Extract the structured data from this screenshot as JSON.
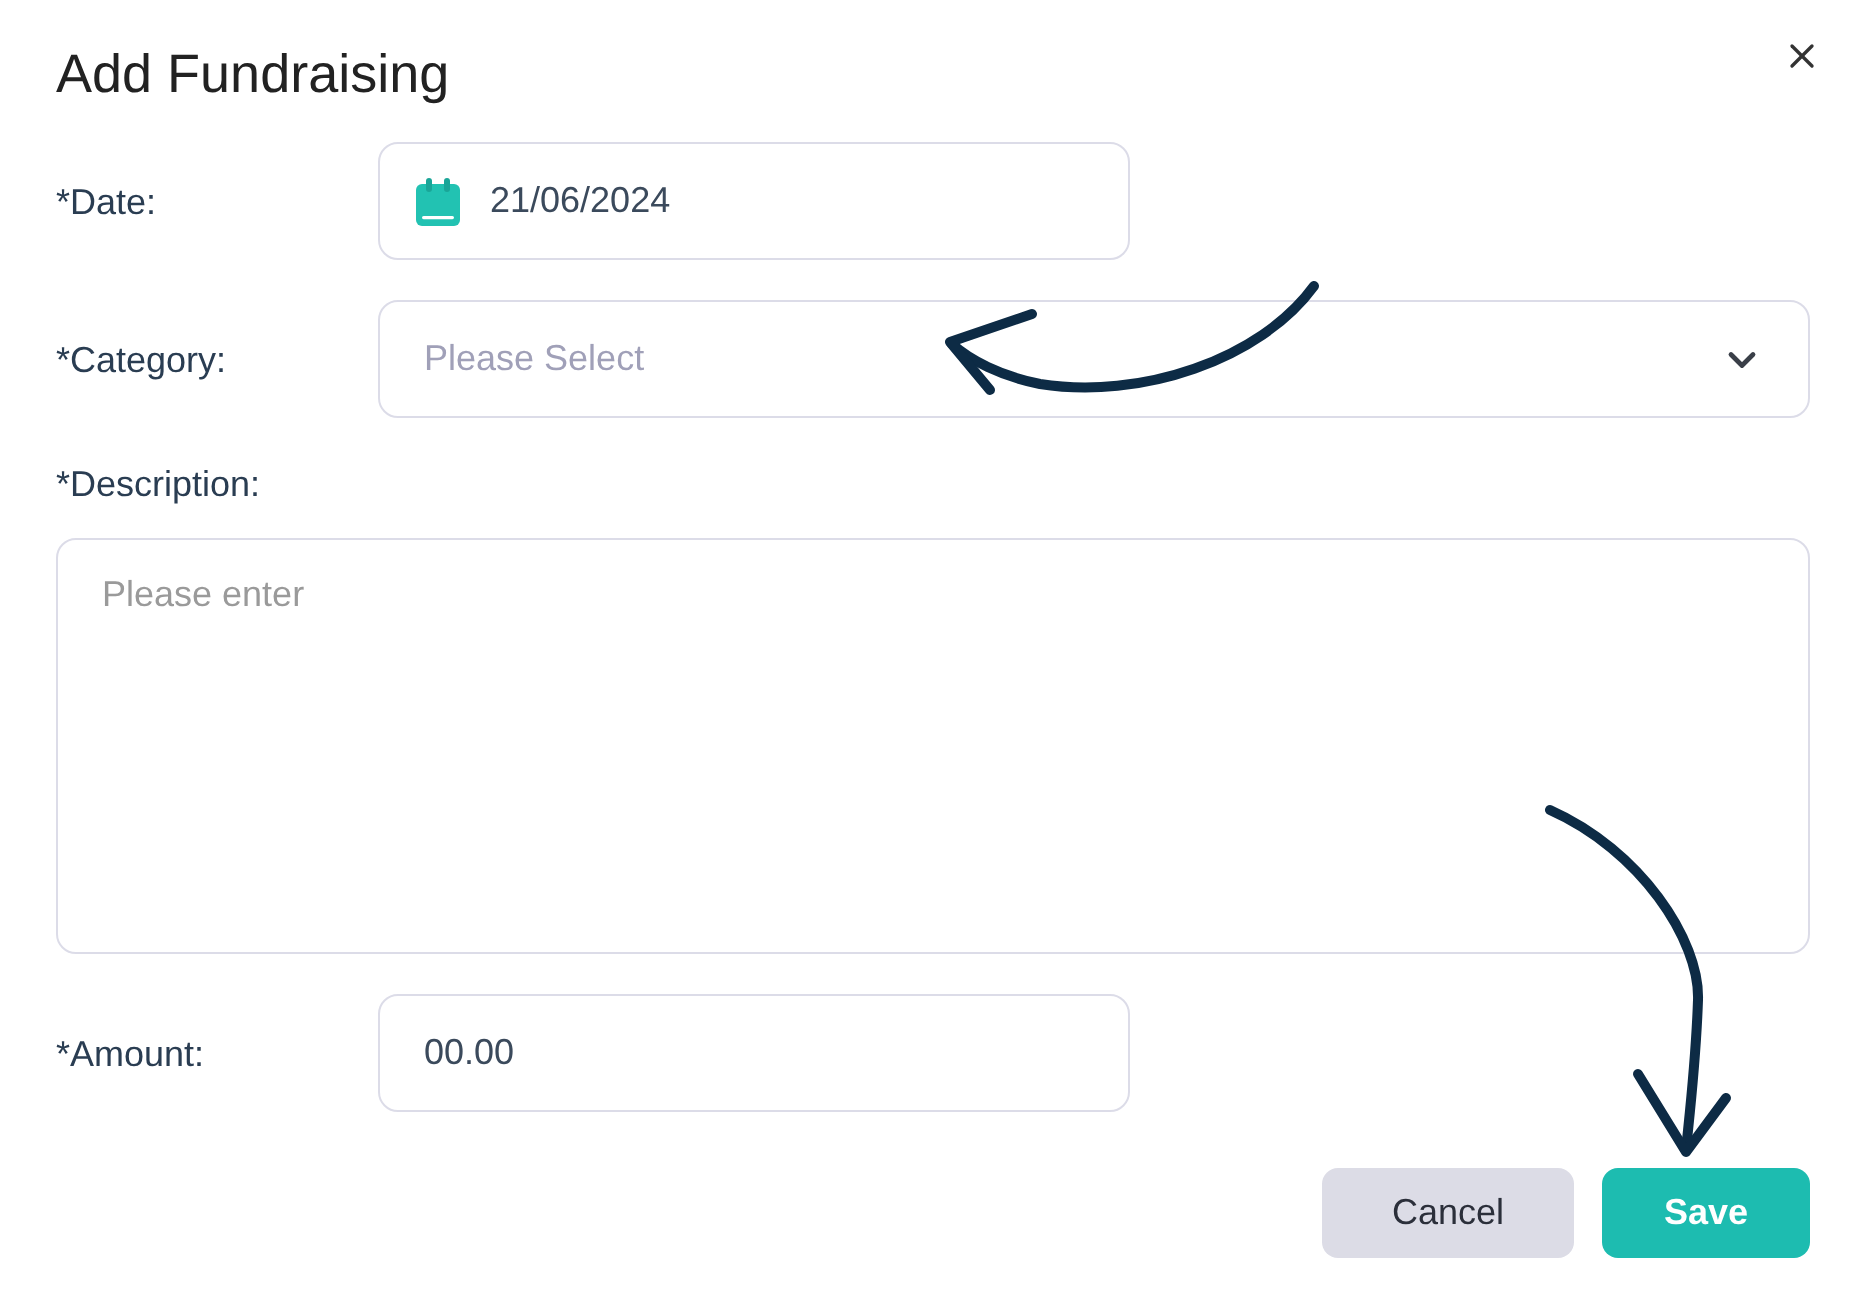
{
  "dialog": {
    "title": "Add Fundraising"
  },
  "fields": [
    {
      "kind": "date",
      "label": "*Date:",
      "value": "21/06/2024"
    },
    {
      "kind": "select",
      "label": "*Category:",
      "placeholder": "Please Select"
    },
    {
      "kind": "textarea",
      "label": "*Description:",
      "placeholder": "Please enter"
    },
    {
      "kind": "text",
      "label": "*Amount:",
      "value": "00.00"
    }
  ],
  "buttons": [
    {
      "kind": "secondary",
      "label": "Cancel"
    },
    {
      "kind": "primary",
      "label": "Save"
    }
  ]
}
